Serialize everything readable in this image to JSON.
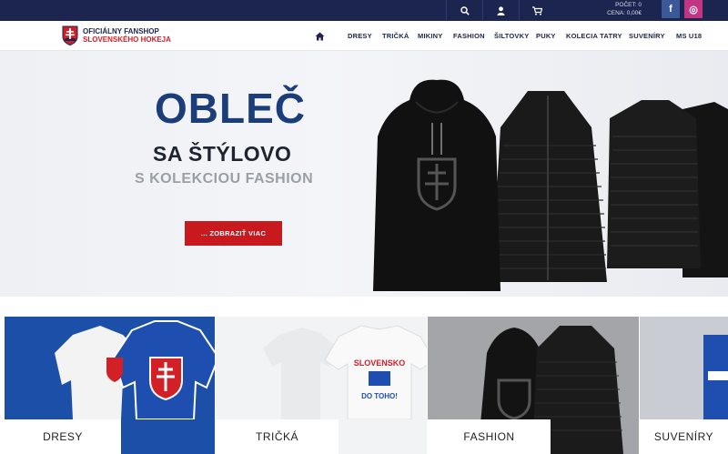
{
  "topbar": {
    "count_label": "POČET: 0",
    "price_label": "CENA: 0,00€",
    "search_icon": "search-icon",
    "user_icon": "user-icon",
    "cart_icon": "cart-icon",
    "facebook": "f",
    "instagram": "◎"
  },
  "logo": {
    "line1": "OFICIÁLNY FANSHOP",
    "line2": "SLOVENSKÉHO HOKEJA"
  },
  "nav": {
    "items": [
      "DRESY",
      "TRIČKÁ",
      "MIKINY",
      "FASHION",
      "ŠILTOVKY",
      "PUKY",
      "KOLECIA TATRY",
      "SUVENÍRY",
      "MS U18"
    ]
  },
  "hero": {
    "title": "OBLEČ",
    "subtitle": "SA ŠTÝLOVO",
    "tagline": "S KOLEKCIOU FASHION",
    "button": "... ZOBRAZIŤ VIAC"
  },
  "tiles": [
    {
      "label": "DRESY"
    },
    {
      "label": "TRIČKÁ"
    },
    {
      "label": "FASHION"
    },
    {
      "label": "SUVENÍRY"
    }
  ],
  "tshirt_print": {
    "line1": "SLOVENSKO",
    "line2": "DO TOHO!"
  },
  "colors": {
    "navy": "#1b2550",
    "red": "#c8191f",
    "blue": "#1c4fa8"
  }
}
